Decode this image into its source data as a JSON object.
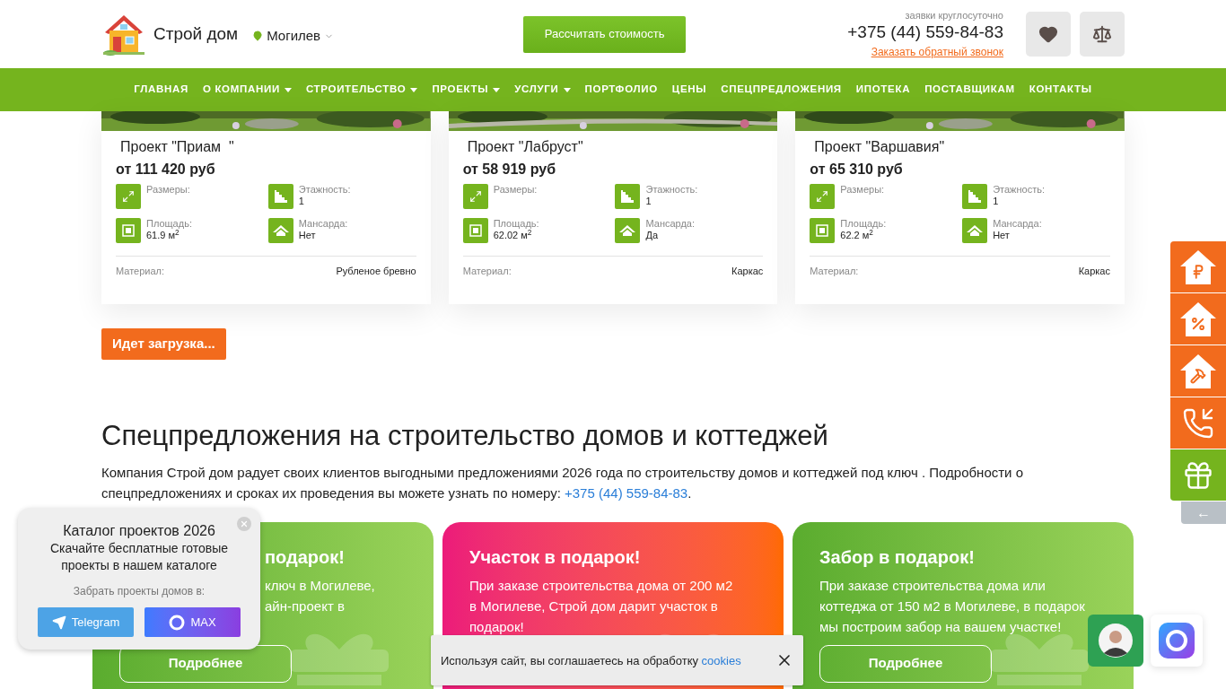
{
  "header": {
    "logo_text": "Строй дом",
    "city": "Могилев",
    "cta": "Рассчитать стоимость",
    "hours_note": "заявки круглосуточно",
    "phone": "+375 (44) 559-84-83",
    "callback_link": "Заказать обратный звонок"
  },
  "nav": [
    {
      "label": "ГЛАВНАЯ",
      "dropdown": false
    },
    {
      "label": "О КОМПАНИИ",
      "dropdown": true
    },
    {
      "label": "СТРОИТЕЛЬСТВО",
      "dropdown": true
    },
    {
      "label": "ПРОЕКТЫ",
      "dropdown": true
    },
    {
      "label": "УСЛУГИ",
      "dropdown": true
    },
    {
      "label": "ПОРТФОЛИО",
      "dropdown": false
    },
    {
      "label": "ЦЕНЫ",
      "dropdown": false
    },
    {
      "label": "СПЕЦПРЕДЛОЖЕНИЯ",
      "dropdown": false
    },
    {
      "label": "ИПОТЕКА",
      "dropdown": false
    },
    {
      "label": "ПОСТАВЩИКАМ",
      "dropdown": false
    },
    {
      "label": "КОНТАКТЫ",
      "dropdown": false
    }
  ],
  "projects": [
    {
      "title": "Проект \"Приам  \"",
      "price": "от 111 420 руб",
      "specs": [
        {
          "kind": "size",
          "label": "Размеры:"
        },
        {
          "kind": "floors",
          "label": "Этажность:",
          "value": "1"
        },
        {
          "kind": "area",
          "label": "Площадь:",
          "value": "61.9 м$^{2}$"
        },
        {
          "kind": "attic",
          "label": "Мансарда:",
          "value": "Нет"
        }
      ],
      "material_label": "Материал:",
      "material": "Рубленое бревно"
    },
    {
      "title": "Проект \"Лабруст\"",
      "price": "от 58 919 руб",
      "specs": [
        {
          "kind": "size",
          "label": "Размеры:"
        },
        {
          "kind": "floors",
          "label": "Этажность:",
          "value": "1"
        },
        {
          "kind": "area",
          "label": "Площадь:",
          "value": "62.02 м$^{2}$"
        },
        {
          "kind": "attic",
          "label": "Мансарда:",
          "value": "Да"
        }
      ],
      "material_label": "Материал:",
      "material": "Каркас"
    },
    {
      "title": "Проект \"Варшавия\"",
      "price": "от 65 310 руб",
      "specs": [
        {
          "kind": "size",
          "label": "Размеры:"
        },
        {
          "kind": "floors",
          "label": "Этажность:",
          "value": "1"
        },
        {
          "kind": "area",
          "label": "Площадь:",
          "value": "62.2 м$^{2}$"
        },
        {
          "kind": "attic",
          "label": "Мансарда:",
          "value": "Нет"
        }
      ],
      "material_label": "Материал:",
      "material": "Каркас"
    }
  ],
  "loading_button": "Идет загрузка...",
  "specials": {
    "heading": "Спецпредложения на строительство домов и коттеджей",
    "intro": "Компания Строй дом радует своих клиентов выгодными предложениями 2026 года по строительству домов и коттеджей под ключ . Подробности о спецпредложениях и сроках их проведения вы можете узнать по номеру: ",
    "intro_link": "+375 (44) 559-84-83",
    "intro_end": "."
  },
  "offers": [
    {
      "kind": "green",
      "title": "подарок!",
      "lines": [
        "ключ в Могилеве,",
        "айн-проект в"
      ],
      "button": "Подробнее"
    },
    {
      "kind": "pink",
      "title": "Участок в подарок!",
      "lines": [
        "При заказе строительства дома от 200 м2",
        "в Могилеве, Строй дом дарит участок в",
        "подарок!"
      ]
    },
    {
      "kind": "green",
      "title": "Забор в подарок!",
      "lines": [
        "При заказе строительства дома или",
        "коттеджа от 150 м2 в Могилеве, в подарок",
        "мы построим забор на вашем участке!"
      ],
      "button": "Подробнее"
    }
  ],
  "side_panel": {
    "buttons": [
      {
        "kind": "price"
      },
      {
        "kind": "percent"
      },
      {
        "kind": "build"
      },
      {
        "kind": "callback"
      },
      {
        "kind": "gift"
      }
    ],
    "collapse": "←"
  },
  "catalog_popup": {
    "title": "Каталог проектов 2026",
    "text": "Скачайте бесплатные готовые проекты в нашем каталоге",
    "subtitle": "Забрать проекты домов в:",
    "buttons": [
      {
        "kind": "telegram",
        "label": "Telegram"
      },
      {
        "kind": "max",
        "label": "MAX"
      }
    ]
  },
  "cookie": {
    "text": "Используя сайт, вы соглашаетесь на обработку",
    "link": "cookies"
  }
}
